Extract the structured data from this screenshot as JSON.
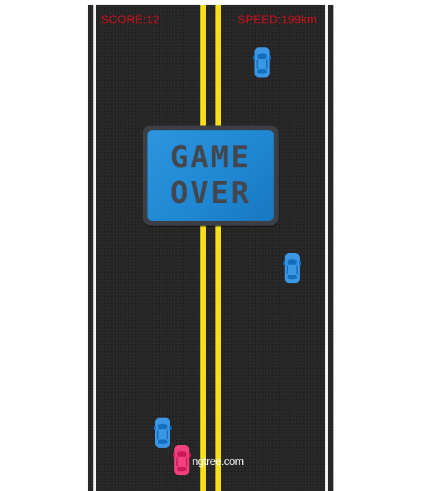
{
  "hud": {
    "score": "SCORE:12",
    "speed": "SPEED:199km"
  },
  "game_over": {
    "line1": "GAME",
    "line2": "OVER"
  },
  "watermark": "ngtree.com",
  "colors": {
    "road": "#262626",
    "center_line": "#f5e01a",
    "edge_line": "#f2f2f2",
    "hud_text": "#d8101a",
    "enemy_car": "#3b97e6",
    "player_car": "#f2417e",
    "sign_face": "#2289d6",
    "sign_border": "#3c3f45",
    "sign_text": "#43474d"
  },
  "cars": [
    {
      "role": "enemy",
      "color_key": "enemy_car"
    },
    {
      "role": "enemy",
      "color_key": "enemy_car"
    },
    {
      "role": "enemy",
      "color_key": "enemy_car"
    },
    {
      "role": "player",
      "color_key": "player_car"
    }
  ]
}
